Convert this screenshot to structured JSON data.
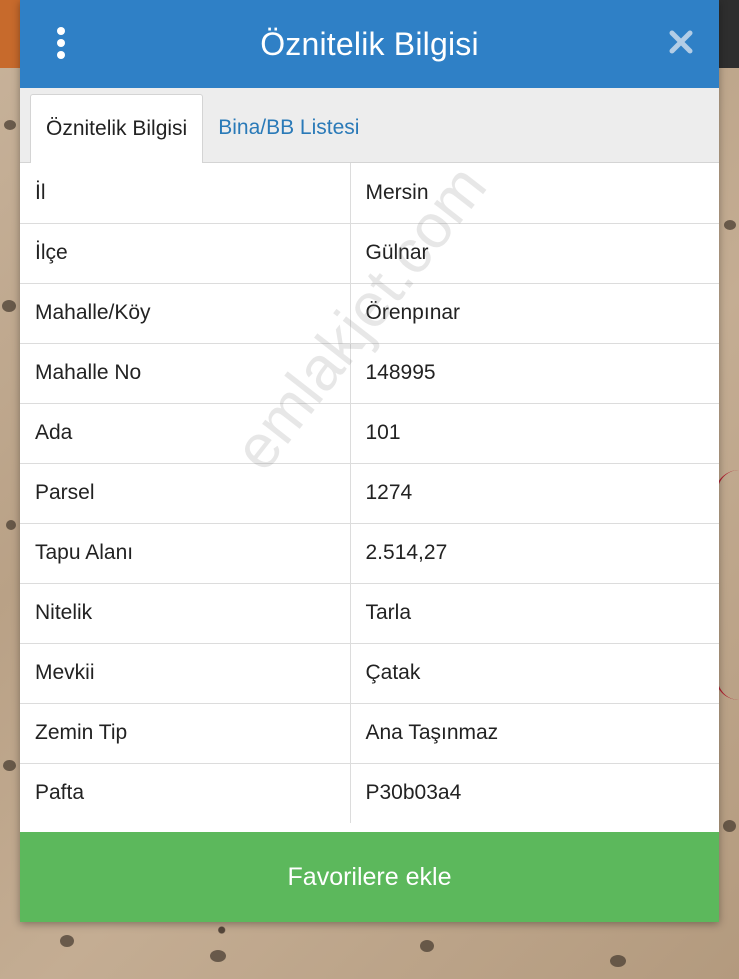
{
  "header": {
    "title": "Öznitelik Bilgisi"
  },
  "tabs": [
    {
      "label": "Öznitelik Bilgisi",
      "active": true
    },
    {
      "label": "Bina/BB Listesi",
      "active": false
    }
  ],
  "attributes": [
    {
      "key": "İl",
      "value": "Mersin"
    },
    {
      "key": "İlçe",
      "value": "Gülnar"
    },
    {
      "key": "Mahalle/Köy",
      "value": "Örenpınar"
    },
    {
      "key": "Mahalle No",
      "value": "148995"
    },
    {
      "key": "Ada",
      "value": "101"
    },
    {
      "key": "Parsel",
      "value": "1274"
    },
    {
      "key": "Tapu Alanı",
      "value": "2.514,27"
    },
    {
      "key": "Nitelik",
      "value": "Tarla"
    },
    {
      "key": "Mevkii",
      "value": "Çatak"
    },
    {
      "key": "Zemin Tip",
      "value": "Ana Taşınmaz"
    },
    {
      "key": "Pafta",
      "value": "P30b03a4"
    }
  ],
  "watermark": "emlakjet.com",
  "footer": {
    "button_label": "Favorilere ekle"
  },
  "colors": {
    "header": "#2f80c6",
    "tab_link": "#2a7ab8",
    "button": "#5cb85c"
  },
  "icons": {
    "menu": "vertical-dots-icon",
    "close": "close-icon"
  }
}
